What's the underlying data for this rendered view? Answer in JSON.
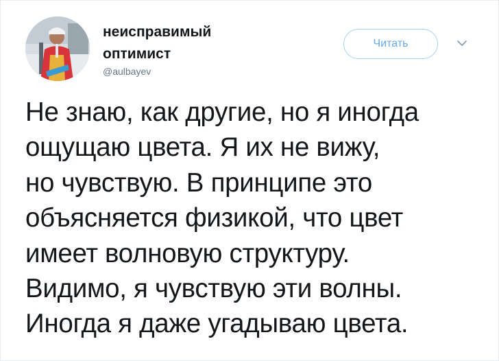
{
  "author": {
    "display_name_line1": "неисправимый",
    "display_name_line2": "оптимист",
    "handle": "@aulbayev"
  },
  "actions": {
    "follow_label": "Читать",
    "menu_icon": "chevron-down-icon"
  },
  "tweet": {
    "lines": [
      "Не знаю, как другие, но я иногда",
      "ощущаю цвета. Я их не вижу,",
      "но чувствую. В принципе это",
      "объясняется физикой, что цвет",
      "имеет волновую структуру.",
      "Видимо, я чувствую эти волны.",
      "Иногда я даже угадываю цвета."
    ]
  },
  "colors": {
    "text": "#14171a",
    "secondary": "#657786",
    "accent": "#64a9e6",
    "accent_border": "#a7d3f5"
  }
}
